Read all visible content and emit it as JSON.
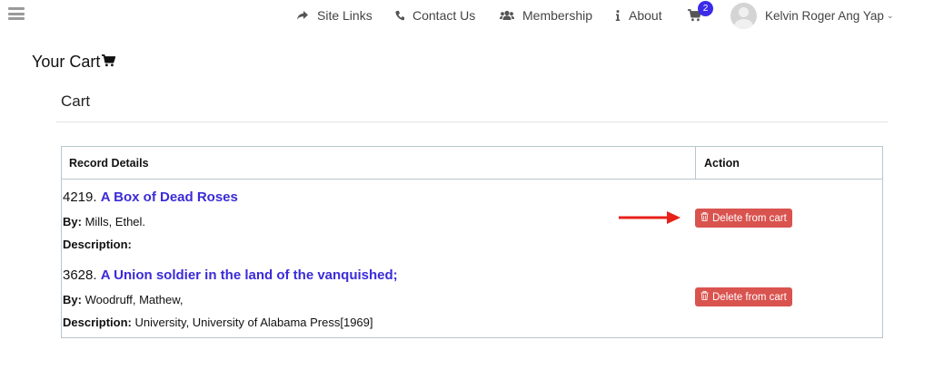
{
  "nav": {
    "menu_icon": "hamburger-icon",
    "items": [
      {
        "label": "Site Links",
        "icon": "share-icon"
      },
      {
        "label": "Contact Us",
        "icon": "phone-icon"
      },
      {
        "label": "Membership",
        "icon": "users-icon"
      },
      {
        "label": "About",
        "icon": "info-icon"
      }
    ],
    "cart_count": "2",
    "user_name": "Kelvin Roger Ang Yap"
  },
  "page": {
    "title": "Your Cart",
    "section_title": "Cart"
  },
  "table": {
    "headers": {
      "record": "Record Details",
      "action": "Action"
    },
    "by_label": "By:",
    "description_label": "Description:",
    "rows": [
      {
        "number": "4219.",
        "title": "A Box of Dead Roses",
        "author": "Mills, Ethel.",
        "description": "",
        "action_label": "Delete from cart"
      },
      {
        "number": "3628.",
        "title": "A Union soldier in the land of the vanquished;",
        "author": "Woodruff, Mathew,",
        "description": "University, University of Alabama Press[1969]",
        "action_label": "Delete from cart"
      }
    ]
  },
  "colors": {
    "accent_link": "#3b2bd8",
    "delete_button": "#d9534f",
    "badge": "#3b2be8",
    "annotation_arrow": "#e8201a"
  }
}
